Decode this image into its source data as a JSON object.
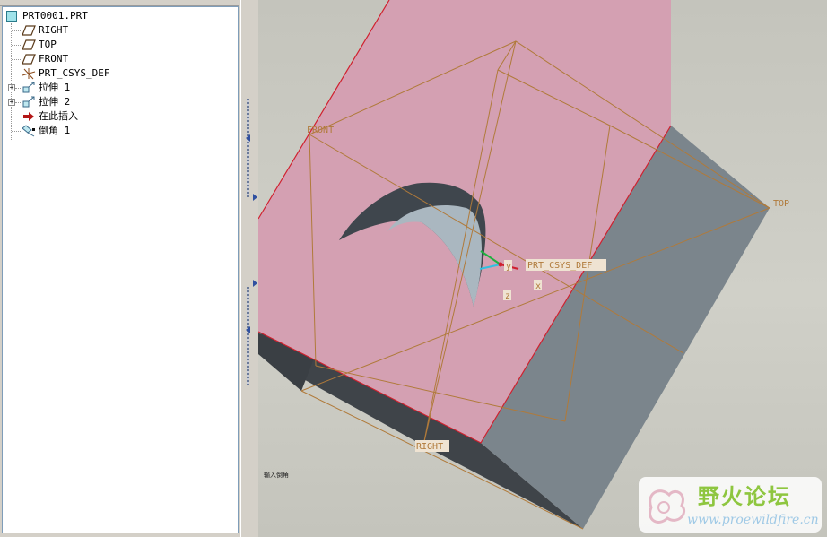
{
  "model_tree": {
    "root": "PRT0001.PRT",
    "items": [
      {
        "label": "RIGHT",
        "icon": "datum-plane-icon"
      },
      {
        "label": "TOP",
        "icon": "datum-plane-icon"
      },
      {
        "label": "FRONT",
        "icon": "datum-plane-icon"
      },
      {
        "label": "PRT_CSYS_DEF",
        "icon": "coordinate-system-icon"
      },
      {
        "label": "拉伸 1",
        "icon": "extrude-icon"
      },
      {
        "label": "拉伸 2",
        "icon": "extrude-icon"
      },
      {
        "label": "在此插入",
        "icon": "insert-here-arrow-icon"
      },
      {
        "label": "倒角 1",
        "icon": "chamfer-icon"
      }
    ]
  },
  "viewport": {
    "datum_labels": {
      "front": "FRONT",
      "top": "TOP",
      "right": "RIGHT",
      "csys": "PRT_CSYS_DEF"
    },
    "axis_labels": {
      "y": "y",
      "z": "z",
      "x": "x"
    },
    "status_message": "输入倒角"
  },
  "watermark": {
    "title": "野火论坛",
    "url": "www.proewildfire.cn"
  },
  "colors": {
    "face_pink": "#d4a0b2",
    "side_gray": "#7b858c",
    "dark_face": "#3e4349",
    "datum_line": "#b07a3a",
    "edge_red": "#d0202e"
  }
}
